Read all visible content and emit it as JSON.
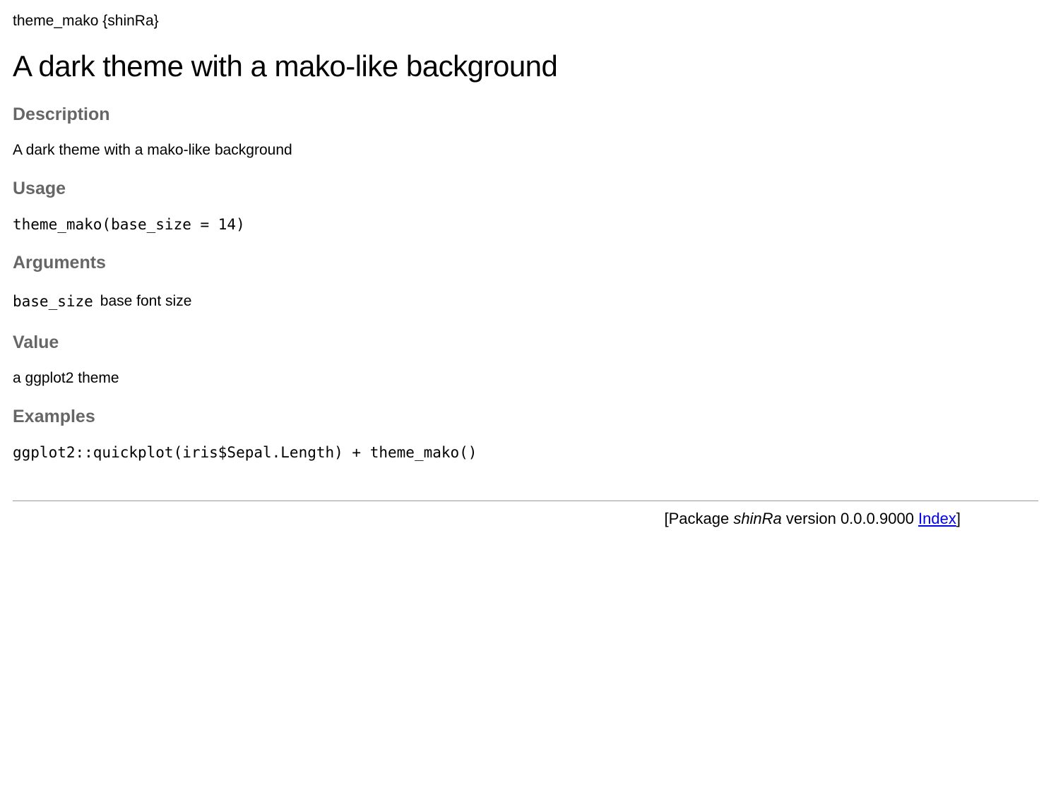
{
  "header": {
    "topic": "theme_mako",
    "package_brace": "{shinRa}"
  },
  "title": "A dark theme with a mako-like background",
  "sections": {
    "description": {
      "heading": "Description",
      "text": "A dark theme with a mako-like background"
    },
    "usage": {
      "heading": "Usage",
      "code": "theme_mako(base_size = 14)"
    },
    "arguments": {
      "heading": "Arguments",
      "rows": [
        {
          "name": "base_size",
          "desc": "base font size"
        }
      ]
    },
    "value": {
      "heading": "Value",
      "text": "a ggplot2 theme"
    },
    "examples": {
      "heading": "Examples",
      "code": "ggplot2::quickplot(iris$Sepal.Length) + theme_mako()"
    }
  },
  "footer": {
    "prefix": "[Package ",
    "package": "shinRa",
    "middle": " version 0.0.0.9000 ",
    "index_label": "Index",
    "suffix": "]"
  }
}
